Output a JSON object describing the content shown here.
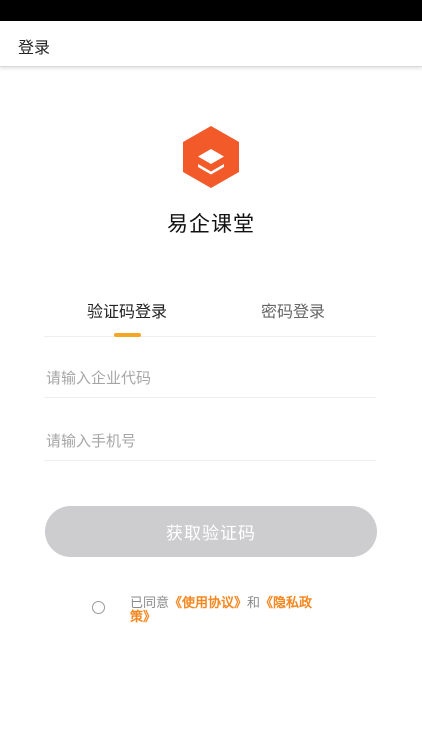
{
  "header": {
    "title": "登录"
  },
  "app": {
    "name": "易企课堂",
    "logo_icon": "hexagon-logo-icon",
    "logo_color": "#f25a2a"
  },
  "tabs": [
    {
      "label": "验证码登录",
      "active": true
    },
    {
      "label": "密码登录",
      "active": false
    }
  ],
  "accent_color": "#f5a623",
  "form": {
    "company_placeholder": "请输入企业代码",
    "company_value": "",
    "phone_placeholder": "请输入手机号",
    "phone_value": ""
  },
  "buttons": {
    "get_code_label": "获取验证码"
  },
  "agreement": {
    "checked": false,
    "prefix": "已同意",
    "terms_link": "《使用协议》",
    "conjunction": "和",
    "privacy_link": "《隐私政策》"
  }
}
